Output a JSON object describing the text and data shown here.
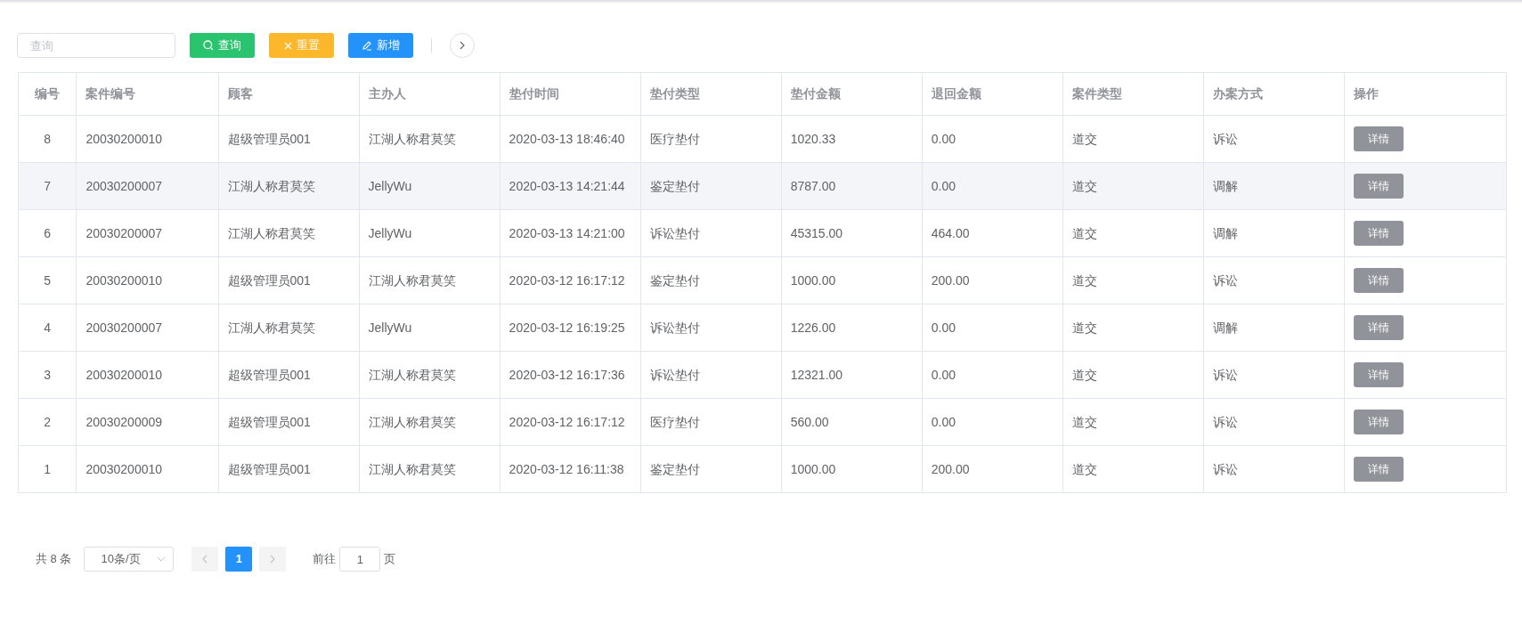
{
  "toolbar": {
    "search": {
      "placeholder": "查询"
    },
    "buttons": [
      {
        "kind": "search",
        "label": "查询"
      },
      {
        "kind": "reset",
        "label": "重置"
      },
      {
        "kind": "add",
        "label": "新增"
      }
    ]
  },
  "table": {
    "columns": [
      "编号",
      "案件编号",
      "顾客",
      "主办人",
      "垫付时间",
      "垫付类型",
      "垫付金额",
      "退回金额",
      "案件类型",
      "办案方式",
      "操作"
    ],
    "rows": [
      {
        "cells": [
          "8",
          "20030200010",
          "超级管理员001",
          "江湖人称君莫笑",
          "2020-03-13 18:46:40",
          "医疗垫付",
          "1020.33",
          "0.00",
          "道交",
          "诉讼"
        ],
        "action": "详情",
        "highlighted": false
      },
      {
        "cells": [
          "7",
          "20030200007",
          "江湖人称君莫笑",
          "JellyWu",
          "2020-03-13 14:21:44",
          "鉴定垫付",
          "8787.00",
          "0.00",
          "道交",
          "调解"
        ],
        "action": "详情",
        "highlighted": true
      },
      {
        "cells": [
          "6",
          "20030200007",
          "江湖人称君莫笑",
          "JellyWu",
          "2020-03-13 14:21:00",
          "诉讼垫付",
          "45315.00",
          "464.00",
          "道交",
          "调解"
        ],
        "action": "详情",
        "highlighted": false
      },
      {
        "cells": [
          "5",
          "20030200010",
          "超级管理员001",
          "江湖人称君莫笑",
          "2020-03-12 16:17:12",
          "鉴定垫付",
          "1000.00",
          "200.00",
          "道交",
          "诉讼"
        ],
        "action": "详情",
        "highlighted": false
      },
      {
        "cells": [
          "4",
          "20030200007",
          "江湖人称君莫笑",
          "JellyWu",
          "2020-03-12 16:19:25",
          "诉讼垫付",
          "1226.00",
          "0.00",
          "道交",
          "调解"
        ],
        "action": "详情",
        "highlighted": false
      },
      {
        "cells": [
          "3",
          "20030200010",
          "超级管理员001",
          "江湖人称君莫笑",
          "2020-03-12 16:17:36",
          "诉讼垫付",
          "12321.00",
          "0.00",
          "道交",
          "诉讼"
        ],
        "action": "详情",
        "highlighted": false
      },
      {
        "cells": [
          "2",
          "20030200009",
          "超级管理员001",
          "江湖人称君莫笑",
          "2020-03-12 16:17:12",
          "医疗垫付",
          "560.00",
          "0.00",
          "道交",
          "诉讼"
        ],
        "action": "详情",
        "highlighted": false
      },
      {
        "cells": [
          "1",
          "20030200010",
          "超级管理员001",
          "江湖人称君莫笑",
          "2020-03-12 16:11:38",
          "鉴定垫付",
          "1000.00",
          "200.00",
          "道交",
          "诉讼"
        ],
        "action": "详情",
        "highlighted": false
      }
    ]
  },
  "pagination": {
    "total": "共 8 条",
    "page_size": "10条/页",
    "pages": [
      {
        "label": "1",
        "selected": true
      }
    ],
    "goto_label": "前往",
    "goto_value": "1",
    "goto_suffix": "页"
  }
}
